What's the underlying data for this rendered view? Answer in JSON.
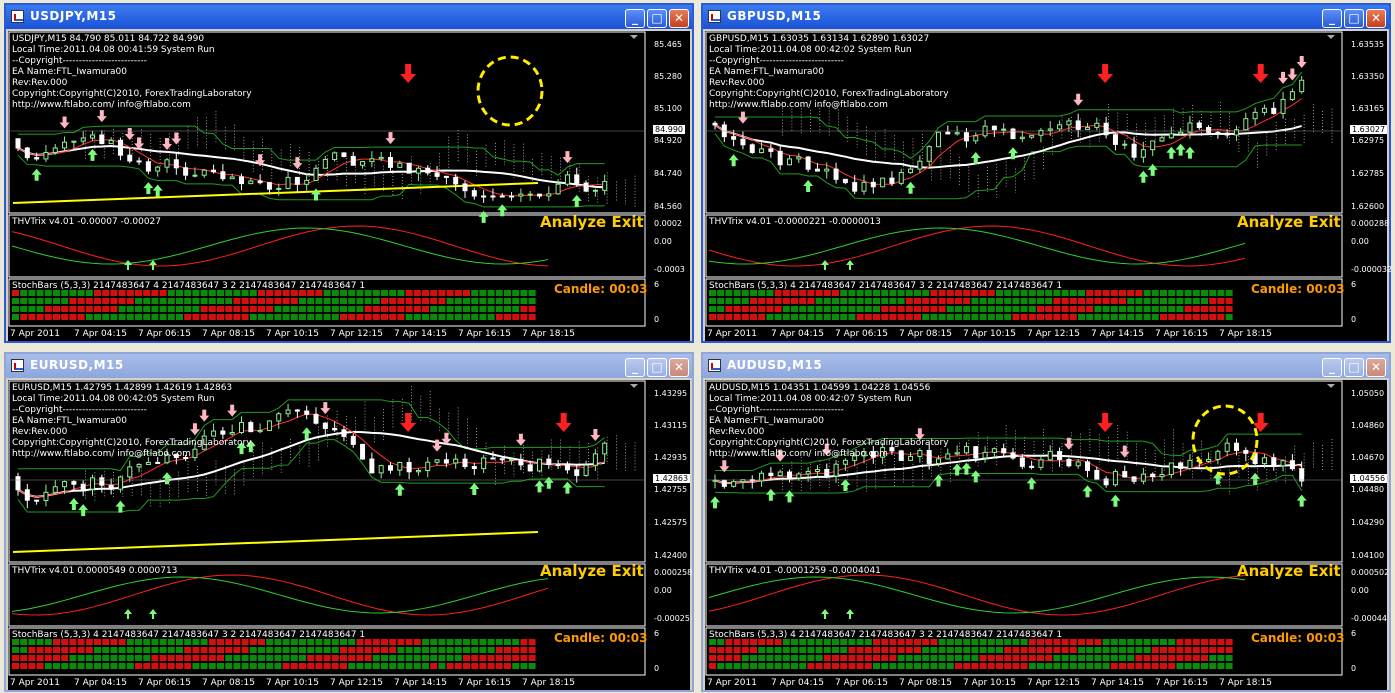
{
  "colors": {
    "up_candle": "#90ee90",
    "down_candle": "#ffffff",
    "arrow_up": "#7cfc7c",
    "arrow_down_light": "#ffb6c1",
    "arrow_down_strong": "#ff2020",
    "ma_fast": "#ff3030",
    "ma_slow": "#ffffff",
    "trend": "#ffff00",
    "stoch_green": "#0a8c0a",
    "stoch_red": "#d21010"
  },
  "windows": [
    {
      "title": "USDJPY,M15",
      "header": [
        "USDJPY,M15  84.790 85.011 84.722 84.990",
        "Local Time:2011.04.08 00:41:59 System Run",
        "--Copyright--------------------------",
        "EA Name:FTL_Iwamura00",
        "Rev:Rev.000",
        "Copyright:Copyright(C)2010, ForexTradingLaboratory",
        "http://www.ftlabo.com/ info@ftlabo.com"
      ],
      "prices": [
        "85.465",
        "85.280",
        "85.100",
        "84.920",
        "84.740",
        "84.560"
      ],
      "current_price": "84.990",
      "ind_label": "THVTrix v4.01 -0.00007 -0.00027",
      "ind_scale": [
        "0.0002",
        "0.00",
        "-0.0003"
      ],
      "stoch_label": "StochBars (5,3,3) 2147483647 4 2147483647 3 2 2147483647 2147483647 1",
      "stoch_scale": [
        "6",
        "0"
      ],
      "analyze": "Analyze Exit",
      "candle": "Candle:  00:03",
      "times": [
        "7 Apr 2011",
        "7 Apr 04:15",
        "7 Apr 06:15",
        "7 Apr 08:15",
        "7 Apr 10:15",
        "7 Apr 12:15",
        "7 Apr 14:15",
        "7 Apr 16:15",
        "7 Apr 18:15"
      ],
      "circle": true,
      "trend": true
    },
    {
      "title": "GBPUSD,M15",
      "header": [
        "GBPUSD,M15  1.63035 1.63134 1.62890 1.63027",
        "Local Time:2011.04.08 00:42:02 System Run",
        "--Copyright--------------------------",
        "EA Name:FTL_Iwamura00",
        "Rev:Rev.000",
        "Copyright:Copyright(C)2010, ForexTradingLaboratory",
        "http://www.ftlabo.com/ info@ftlabo.com"
      ],
      "prices": [
        "1.63535",
        "1.63350",
        "1.63165",
        "1.62975",
        "1.62785",
        "1.62600"
      ],
      "current_price": "1.63027",
      "ind_label": "THVTrix v4.01 -0.0000221 -0.0000013",
      "ind_scale": [
        "0.000288",
        "0.00",
        "-0.000032"
      ],
      "stoch_label": "StochBars (5,3,3) 4 2147483647 2147483647 3 2 2147483647 2147483647 1",
      "stoch_scale": [
        "6",
        "0"
      ],
      "analyze": "Analyze Exit",
      "candle": "Candle:  00:03",
      "times": [
        "7 Apr 2011",
        "7 Apr 04:15",
        "7 Apr 06:15",
        "7 Apr 08:15",
        "7 Apr 10:15",
        "7 Apr 12:15",
        "7 Apr 14:15",
        "7 Apr 16:15",
        "7 Apr 18:15"
      ],
      "circle": false,
      "trend": false
    },
    {
      "title": "EURUSD,M15",
      "header": [
        "EURUSD,M15  1.42795 1.42899 1.42619 1.42863",
        "Local Time:2011.04.08 00:42:05 System Run",
        "--Copyright--------------------------",
        "EA Name:FTL_Iwamura00",
        "Rev:Rev.000",
        "Copyright:Copyright(C)2010, ForexTradingLaboratory",
        "http://www.ftlabo.com/ info@ftlabo.com"
      ],
      "prices": [
        "1.43295",
        "1.43115",
        "1.42935",
        "1.42755",
        "1.42575",
        "1.42400"
      ],
      "current_price": "1.42863",
      "ind_label": "THVTrix v4.01 0.0000549 0.0000713",
      "ind_scale": [
        "0.000258",
        "0.00",
        "-0.00025"
      ],
      "stoch_label": "StochBars (5,3,3) 4 2147483647 2147483647 3 2 2147483647 2147483647 1",
      "stoch_scale": [
        "6",
        "0"
      ],
      "analyze": "Analyze Exit",
      "candle": "Candle:  00:03",
      "times": [
        "7 Apr 2011",
        "7 Apr 04:15",
        "7 Apr 06:15",
        "7 Apr 08:15",
        "7 Apr 10:15",
        "7 Apr 12:15",
        "7 Apr 14:15",
        "7 Apr 16:15",
        "7 Apr 18:15"
      ],
      "circle": false,
      "trend": true
    },
    {
      "title": "AUDUSD,M15",
      "header": [
        "AUDUSD,M15  1.04351 1.04599 1.04228 1.04556",
        "Local Time:2011.04.08 00:42:07 System Run",
        "--Copyright--------------------------",
        "EA Name:FTL_Iwamura00",
        "Rev:Rev.000",
        "Copyright:Copyright(C)2010, ForexTradingLaboratory",
        "http://www.ftlabo.com/ info@ftlabo.com"
      ],
      "prices": [
        "1.05050",
        "1.04860",
        "1.04670",
        "1.04480",
        "1.04290",
        "1.04100"
      ],
      "current_price": "1.04556",
      "ind_label": "THVTrix v4.01 -0.0001259 -0.0004041",
      "ind_scale": [
        "0.000502",
        "0.00",
        "-0.00044"
      ],
      "stoch_label": "StochBars (5,3,3) 4 2147483647 2147483647 3 2 2147483647 2147483647 1",
      "stoch_scale": [
        "6",
        "0"
      ],
      "analyze": "Analyze Exit",
      "candle": "Candle:  00:03",
      "times": [
        "7 Apr 2011",
        "7 Apr 04:15",
        "7 Apr 06:15",
        "7 Apr 08:15",
        "7 Apr 10:15",
        "7 Apr 12:15",
        "7 Apr 14:15",
        "7 Apr 16:15",
        "7 Apr 18:15"
      ],
      "circle": true,
      "trend": false
    }
  ]
}
